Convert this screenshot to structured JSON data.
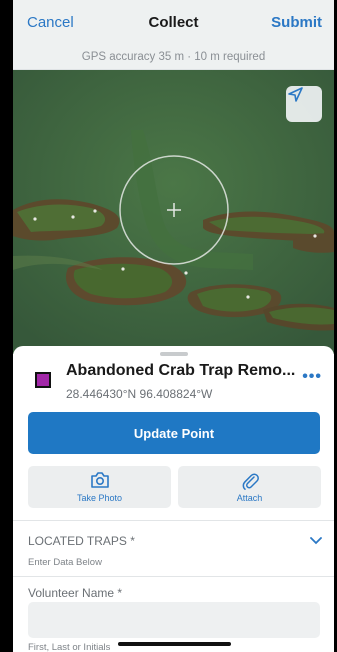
{
  "nav": {
    "cancel": "Cancel",
    "title": "Collect",
    "submit": "Submit"
  },
  "gps": {
    "status": "GPS accuracy 35 m · 10 m required"
  },
  "feature": {
    "title": "Abandoned Crab Trap Remo...",
    "coordinates": "28.446430°N 96.408824°W",
    "more": "•••",
    "swatch_color": "#a227a8"
  },
  "actions": {
    "update": "Update Point",
    "take_photo": "Take Photo",
    "attach": "Attach"
  },
  "form": {
    "located_traps_label": "LOCATED TRAPS *",
    "located_traps_hint": "Enter Data Below",
    "volunteer_label": "Volunteer Name *",
    "volunteer_value": "",
    "volunteer_hint": "First, Last or Initials"
  },
  "colors": {
    "accent": "#2b78c5",
    "button": "#1f78c4"
  }
}
